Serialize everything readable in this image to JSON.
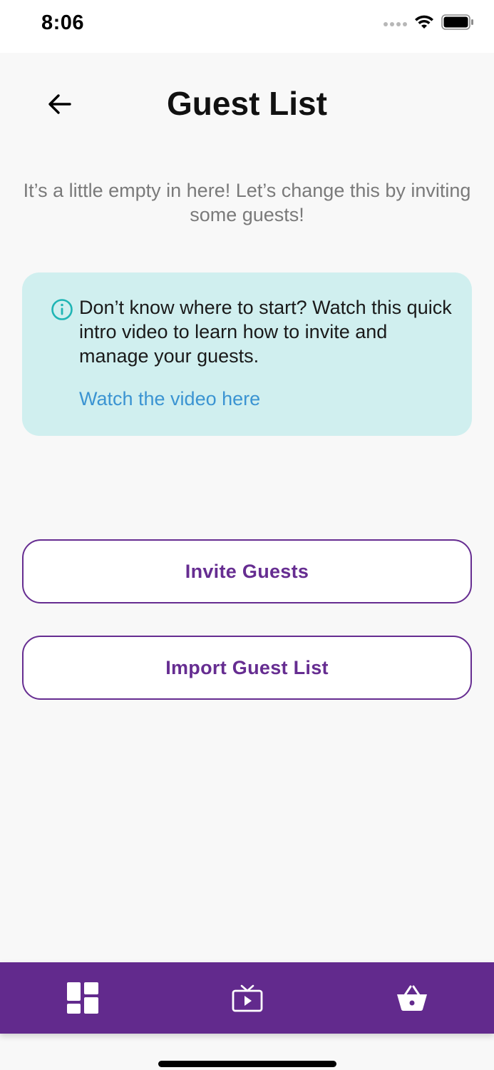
{
  "status_bar": {
    "time": "8:06"
  },
  "header": {
    "title": "Guest List",
    "back_icon": "arrow-left-icon"
  },
  "empty_state": {
    "message": "It’s a little empty in here! Let’s change this by inviting some guests!"
  },
  "info_card": {
    "icon": "info-circle-icon",
    "text": "Don’t know where to start? Watch this quick intro video to learn how to invite and manage your guests.",
    "link_label": "Watch the video here"
  },
  "actions": {
    "invite_label": "Invite Guests",
    "import_label": "Import Guest List"
  },
  "bottom_nav": {
    "items": [
      {
        "icon": "dashboard-icon"
      },
      {
        "icon": "tv-play-icon"
      },
      {
        "icon": "basket-icon"
      }
    ]
  },
  "colors": {
    "brand_purple": "#622a8d",
    "button_text": "#662d91",
    "info_bg": "#d0efef",
    "info_icon": "#1fb5b5",
    "link": "#3b94d2"
  }
}
